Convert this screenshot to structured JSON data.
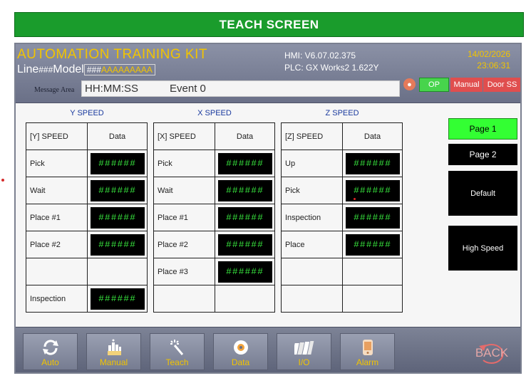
{
  "banner": "TEACH SCREEN",
  "header": {
    "title": "AUTOMATION TRAINING KIT",
    "line_label": "Line",
    "line_value": "###",
    "model_label": "Model",
    "model_value": "###",
    "model_text": "AAAAAAAAA",
    "hmi": "HMI: V6.07.02.375",
    "plc": "PLC: GX Works2 1.622Y",
    "date": "14/02/2026",
    "time": "23:06:31"
  },
  "message": {
    "label": "Message Area",
    "time": "HH:MM:SS",
    "event": "Event 0"
  },
  "status": {
    "op": "OP",
    "manual": "Manual",
    "door": "Door SS"
  },
  "y_speed": {
    "title": "Y SPEED",
    "col1": "[Y] SPEED",
    "col2": "Data",
    "rows": [
      {
        "label": "Pick",
        "value": "######"
      },
      {
        "label": "Wait",
        "value": "######"
      },
      {
        "label": "Place #1",
        "value": "######"
      },
      {
        "label": "Place #2",
        "value": "######"
      },
      {
        "label": "",
        "value": ""
      },
      {
        "label": "Inspection",
        "value": "######"
      }
    ]
  },
  "x_speed": {
    "title": "X SPEED",
    "col1": "[X] SPEED",
    "col2": "Data",
    "rows": [
      {
        "label": "Pick",
        "value": "######"
      },
      {
        "label": "Wait",
        "value": "######"
      },
      {
        "label": "Place #1",
        "value": "######"
      },
      {
        "label": "Place #2",
        "value": "######"
      },
      {
        "label": "Place #3",
        "value": "######"
      },
      {
        "label": "",
        "value": ""
      }
    ]
  },
  "z_speed": {
    "title": "Z SPEED",
    "col1": "[Z] SPEED",
    "col2": "Data",
    "rows": [
      {
        "label": "Up",
        "value": "######"
      },
      {
        "label": "Pick",
        "value": "######"
      },
      {
        "label": "Inspection",
        "value": "######"
      },
      {
        "label": "Place",
        "value": "######"
      },
      {
        "label": "",
        "value": ""
      },
      {
        "label": "",
        "value": ""
      }
    ]
  },
  "side_buttons": {
    "page1": "Page 1",
    "page2": "Page 2",
    "default": "Default",
    "high_speed": "High Speed"
  },
  "nav": [
    {
      "label": "Auto",
      "icon": "refresh-icon"
    },
    {
      "label": "Manual",
      "icon": "hand-icon"
    },
    {
      "label": "Teach",
      "icon": "wand-icon"
    },
    {
      "label": "Data",
      "icon": "disc-icon"
    },
    {
      "label": "I/O",
      "icon": "cards-icon"
    },
    {
      "label": "Alarm",
      "icon": "phone-icon"
    }
  ],
  "back": "BACK",
  "colors": {
    "banner": "#1a9c2c",
    "accent": "#f2c400",
    "value_text": "#37e23d",
    "page_active": "#33ff33",
    "status_red": "#e04e4e"
  }
}
